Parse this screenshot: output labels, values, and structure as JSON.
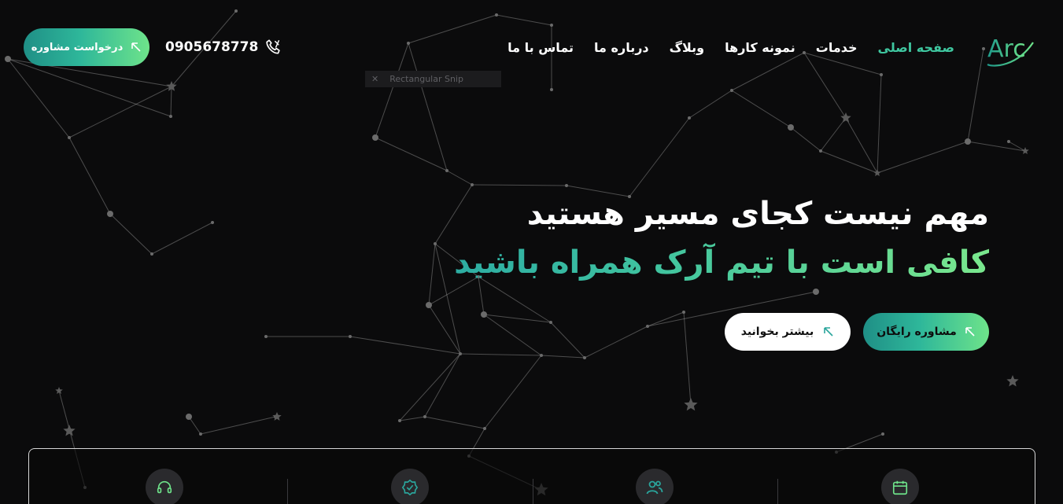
{
  "brand": {
    "logo_text": "Arc",
    "accent": "#3fc7a0"
  },
  "nav": {
    "items": [
      {
        "label": "صفحه اصلی",
        "active": true
      },
      {
        "label": "خدمات",
        "active": false
      },
      {
        "label": "نمونه کارها",
        "active": false
      },
      {
        "label": "وبلاگ",
        "active": false
      },
      {
        "label": "درباره ما",
        "active": false
      },
      {
        "label": "تماس با ما",
        "active": false
      }
    ]
  },
  "header": {
    "phone": "0905678778",
    "phone_icon": "phone-icon",
    "consult_button": "درخواست مشاوره"
  },
  "snip": {
    "label": "Rectangular Snip"
  },
  "hero": {
    "title": "مهم نیست کجای مسیر هستید",
    "subtitle": "کافی است با تیم آرک همراه باشید",
    "primary_button": "مشاوره رایگان",
    "secondary_button": "بیشتر بخوانید"
  },
  "features": {
    "icons": [
      "calendar-icon",
      "users-icon",
      "verified-icon",
      "headset-icon"
    ]
  }
}
